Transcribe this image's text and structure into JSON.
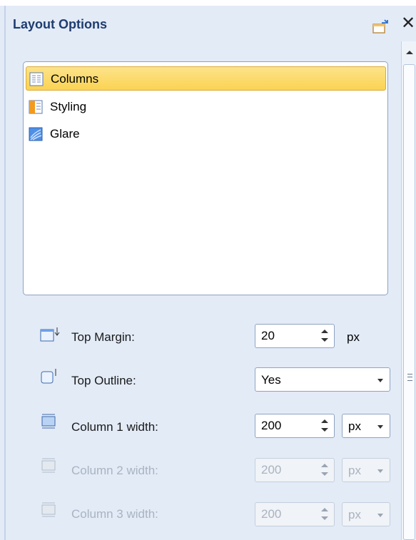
{
  "panel": {
    "title": "Layout Options"
  },
  "list": {
    "items": [
      {
        "label": "Columns",
        "icon": "columns-icon",
        "selected": true
      },
      {
        "label": "Styling",
        "icon": "styling-icon",
        "selected": false
      },
      {
        "label": "Glare",
        "icon": "glare-icon",
        "selected": false
      }
    ]
  },
  "fields": {
    "top_margin": {
      "label": "Top Margin:",
      "value": "20",
      "unit": "px"
    },
    "top_outline": {
      "label": "Top Outline:",
      "value": "Yes"
    },
    "column1": {
      "label": "Column 1 width:",
      "value": "200",
      "unit": "px"
    },
    "column2": {
      "label": "Column 2 width:",
      "value": "200",
      "unit": "px",
      "disabled": true
    },
    "column3": {
      "label": "Column 3 width:",
      "value": "200",
      "unit": "px",
      "disabled": true
    }
  },
  "colors": {
    "selection": "#fbd352",
    "panel_bg": "#e3ebf7",
    "title": "#1e3c6e",
    "disabled_text": "#a9b3c1"
  }
}
